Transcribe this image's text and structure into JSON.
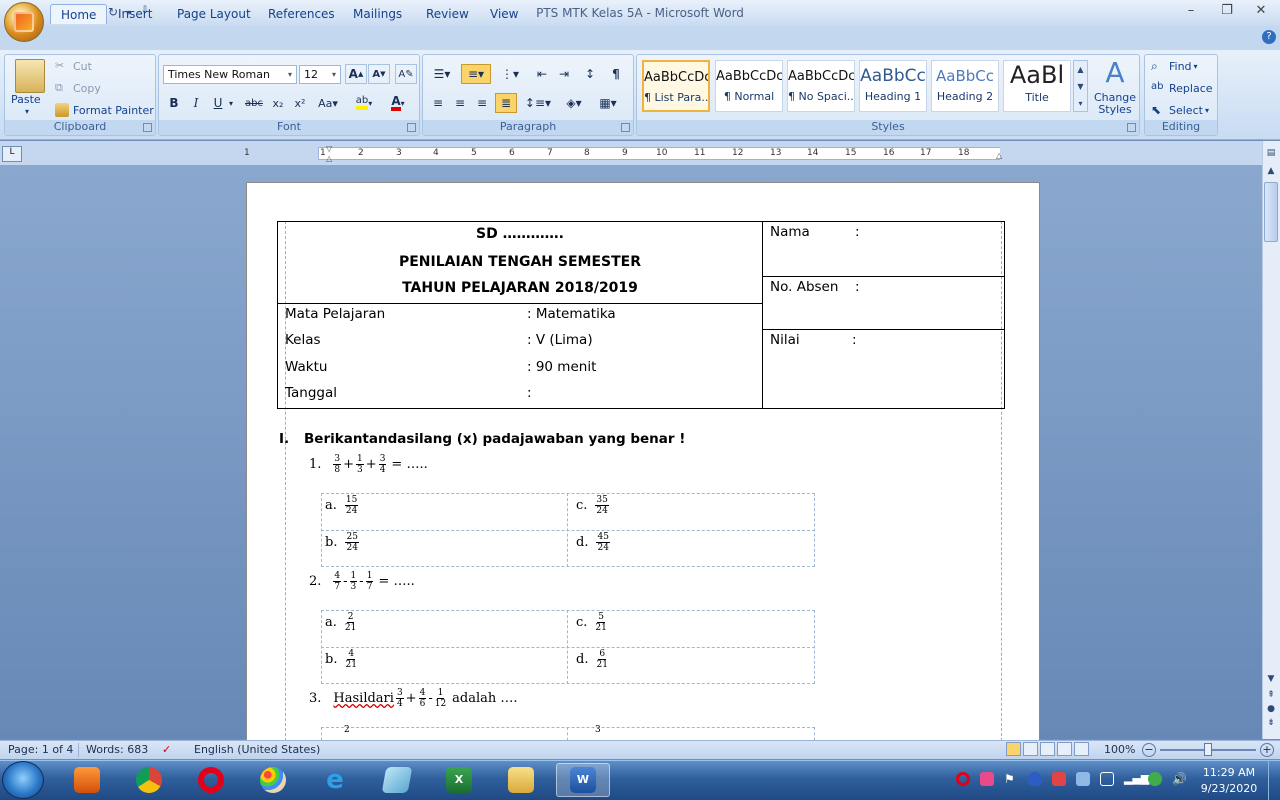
{
  "window": {
    "title": "PTS MTK Kelas 5A - Microsoft Word"
  },
  "qat": {
    "save_icon": "save-icon",
    "undo_icon": "undo-icon",
    "redo_icon": "redo-icon",
    "customize_icon": "customize-icon"
  },
  "tabs": [
    "Home",
    "Insert",
    "Page Layout",
    "References",
    "Mailings",
    "Review",
    "View"
  ],
  "clipboard": {
    "paste": "Paste",
    "cut": "Cut",
    "copy": "Copy",
    "format_painter": "Format Painter",
    "label": "Clipboard"
  },
  "font": {
    "name": "Times New Roman",
    "size": "12",
    "label": "Font"
  },
  "paragraph": {
    "label": "Paragraph"
  },
  "styles": {
    "label": "Styles",
    "items": [
      {
        "sample": "AaBbCcDc",
        "name": "¶ List Para..."
      },
      {
        "sample": "AaBbCcDc",
        "name": "¶ Normal"
      },
      {
        "sample": "AaBbCcDc",
        "name": "¶ No Spaci..."
      },
      {
        "sample": "AaBbCc",
        "name": "Heading 1"
      },
      {
        "sample": "AaBbCc",
        "name": "Heading 2"
      },
      {
        "sample": "AaBl",
        "name": "Title"
      }
    ],
    "change": "Change Styles"
  },
  "editing": {
    "find": "Find",
    "replace": "Replace",
    "select": "Select",
    "label": "Editing"
  },
  "ruler": [
    "1",
    "1",
    "2",
    "3",
    "4",
    "5",
    "6",
    "7",
    "8",
    "9",
    "10",
    "11",
    "12",
    "13",
    "14",
    "15",
    "16",
    "17",
    "18"
  ],
  "doc": {
    "school": "SD ………….",
    "exam_title": "PENILAIAN TENGAH SEMESTER",
    "year": "TAHUN PELAJARAN 2018/2019",
    "info": [
      {
        "label": "Mata Pelajaran",
        "value": ": Matematika"
      },
      {
        "label": "Kelas",
        "value": ": V (Lima)"
      },
      {
        "label": "Waktu",
        "value": ": 90 menit"
      },
      {
        "label": "Tanggal",
        "value": ":"
      }
    ],
    "side": [
      {
        "label": "Nama",
        "colon": ":"
      },
      {
        "label": "No. Absen",
        "colon": ":"
      },
      {
        "label": "Nilai",
        "colon": ":"
      }
    ],
    "section_num": "I.",
    "instruction": "Berikantandasilang (x) padajawaban yang benar !",
    "q1": {
      "num": "1.",
      "fracs": [
        [
          "3",
          "8"
        ],
        [
          "1",
          "3"
        ],
        [
          "3",
          "4"
        ]
      ],
      "ops": [
        "+",
        "+"
      ],
      "tail": "= ….."
    },
    "q1_opts": [
      {
        "letter": "a.",
        "n": "15",
        "d": "24"
      },
      {
        "letter": "c.",
        "n": "35",
        "d": "24"
      },
      {
        "letter": "b.",
        "n": "25",
        "d": "24"
      },
      {
        "letter": "d.",
        "n": "45",
        "d": "24"
      }
    ],
    "q2": {
      "num": "2.",
      "fracs": [
        [
          "4",
          "7"
        ],
        [
          "1",
          "3"
        ],
        [
          "1",
          "7"
        ]
      ],
      "ops": [
        "-",
        "-"
      ],
      "tail": "= ….."
    },
    "q2_opts": [
      {
        "letter": "a.",
        "n": "2",
        "d": "21"
      },
      {
        "letter": "c.",
        "n": "5",
        "d": "21"
      },
      {
        "letter": "b.",
        "n": "4",
        "d": "21"
      },
      {
        "letter": "d.",
        "n": "6",
        "d": "21"
      }
    ],
    "q3": {
      "num": "3.",
      "lead": "Hasildari",
      "fracs": [
        [
          "3",
          "4"
        ],
        [
          "4",
          "6"
        ],
        [
          "1",
          "12"
        ]
      ],
      "ops": [
        "+",
        "-"
      ],
      "tail": "adalah …."
    },
    "q3_partial": [
      {
        "n": "2"
      },
      {
        "n": "3"
      }
    ]
  },
  "status": {
    "page": "Page: 1 of 4",
    "words": "Words: 683",
    "lang": "English (United States)",
    "zoom": "100%"
  },
  "taskbar": {
    "time": "11:29 AM",
    "date": "9/23/2020"
  }
}
